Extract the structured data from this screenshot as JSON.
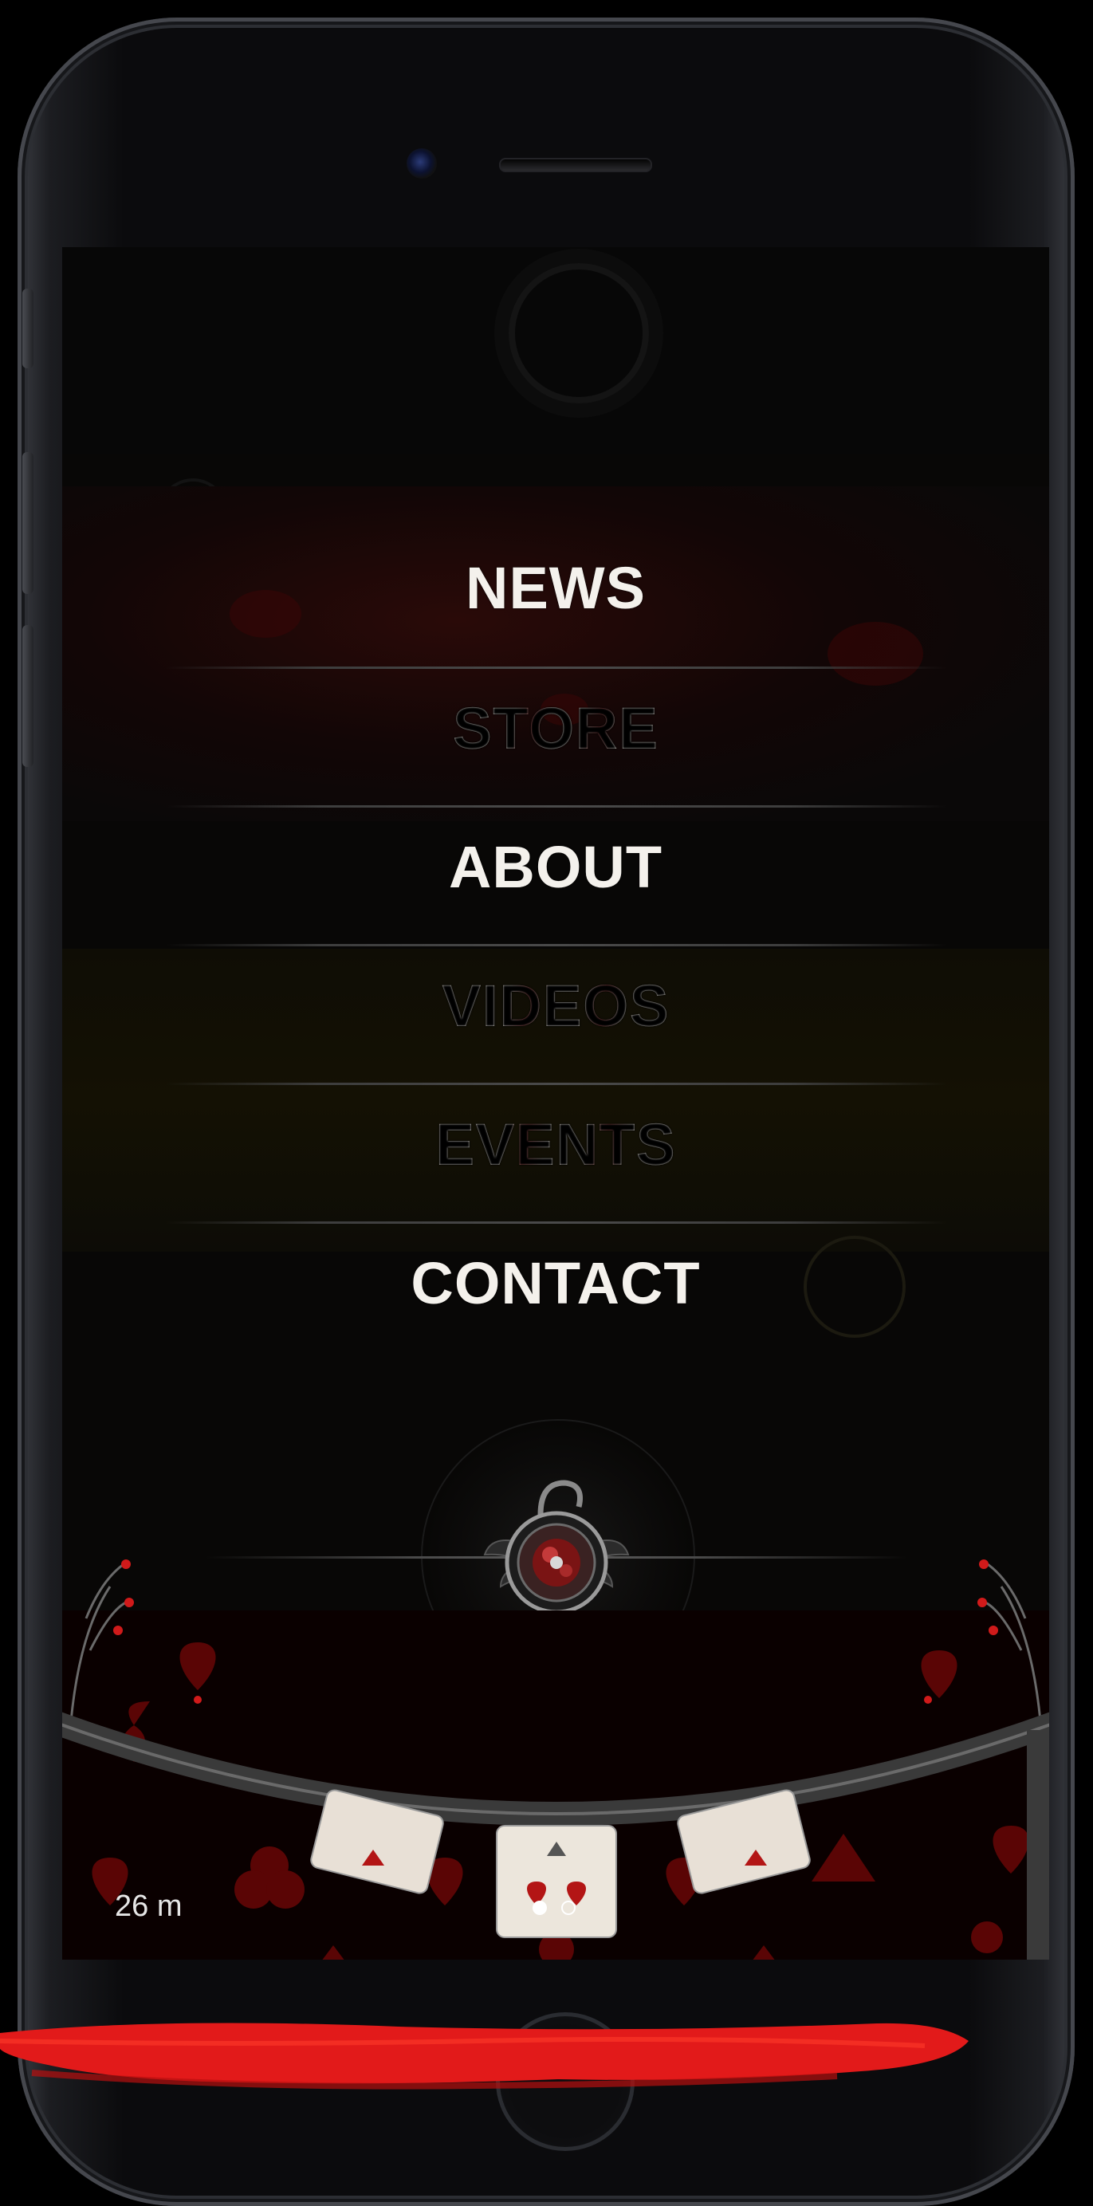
{
  "menu": {
    "items": [
      {
        "label": "NEWS"
      },
      {
        "label": "STORE"
      },
      {
        "label": "ABOUT"
      },
      {
        "label": "VIDEOS"
      },
      {
        "label": "EVENTS"
      },
      {
        "label": "CONTACT"
      }
    ]
  },
  "status": {
    "page_counter": "26 m"
  },
  "pagination": {
    "total_pages": 2,
    "current_page": 1
  },
  "colors": {
    "accent_red": "#e21a1a",
    "menu_text": "#f4f1ec",
    "background": "#080706"
  }
}
